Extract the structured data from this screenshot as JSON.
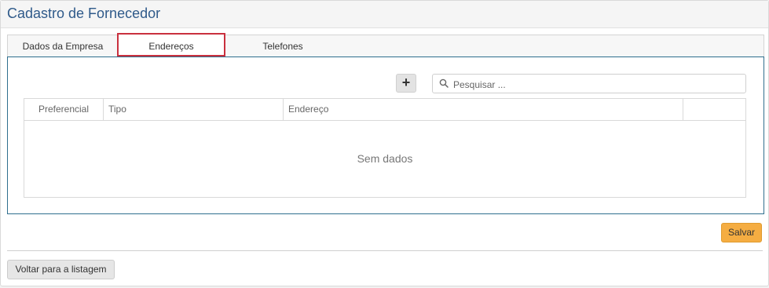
{
  "page": {
    "title": "Cadastro de Fornecedor"
  },
  "tabs": [
    {
      "label": "Dados da Empresa",
      "active": false
    },
    {
      "label": "Endereços",
      "active": true
    },
    {
      "label": "Telefones",
      "active": false
    }
  ],
  "toolbar": {
    "add_label": "+",
    "search_placeholder": "Pesquisar ...",
    "search_value": ""
  },
  "grid": {
    "columns": [
      "Preferencial",
      "Tipo",
      "Endereço",
      ""
    ],
    "rows": [],
    "empty_text": "Sem dados"
  },
  "actions": {
    "save_label": "Salvar",
    "back_label": "Voltar para a listagem"
  },
  "colors": {
    "title": "#2f5a8a",
    "active_tab_border": "#c9303e",
    "content_border": "#2f6f8e",
    "save_button": "#f5ad42"
  },
  "icons": {
    "search": "search-icon",
    "add": "plus-icon"
  }
}
